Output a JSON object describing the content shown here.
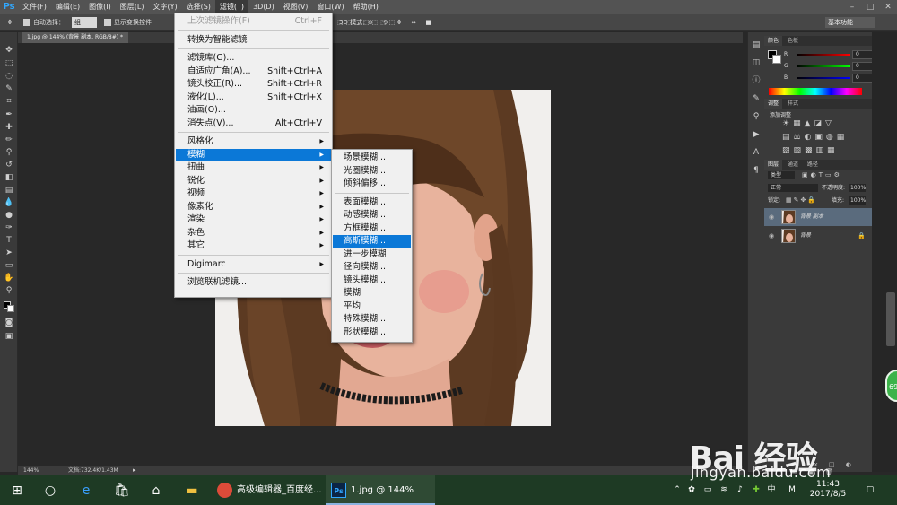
{
  "menubar": {
    "logo": "Ps",
    "items": [
      "文件(F)",
      "编辑(E)",
      "图像(I)",
      "图层(L)",
      "文字(Y)",
      "选择(S)",
      "滤镜(T)",
      "3D(D)",
      "视图(V)",
      "窗口(W)",
      "帮助(H)"
    ],
    "active_index": 6
  },
  "options_bar": {
    "auto_select_label": "自动选择：",
    "auto_select_value": "组",
    "transform_label": "显示变换控件",
    "mode_label": "3D 模式：",
    "workspace": "基本功能"
  },
  "document": {
    "tab_title": "1.jpg @ 144% (背景 副本, RGB/8#) *"
  },
  "status_bar": {
    "zoom": "144%",
    "doc_info": "文档:732.4K/1.43M"
  },
  "filter_menu": {
    "items": [
      {
        "label": "上次滤镜操作(F)",
        "shortcut": "Ctrl+F",
        "disabled": true
      },
      {
        "sep": true
      },
      {
        "label": "转换为智能滤镜"
      },
      {
        "sep": true
      },
      {
        "label": "滤镜库(G)..."
      },
      {
        "label": "自适应广角(A)...",
        "shortcut": "Shift+Ctrl+A"
      },
      {
        "label": "镜头校正(R)...",
        "shortcut": "Shift+Ctrl+R"
      },
      {
        "label": "液化(L)...",
        "shortcut": "Shift+Ctrl+X"
      },
      {
        "label": "油画(O)..."
      },
      {
        "label": "消失点(V)...",
        "shortcut": "Alt+Ctrl+V"
      },
      {
        "sep": true
      },
      {
        "label": "风格化",
        "submenu": true
      },
      {
        "label": "模糊",
        "submenu": true,
        "highlighted": true
      },
      {
        "label": "扭曲",
        "submenu": true
      },
      {
        "label": "锐化",
        "submenu": true
      },
      {
        "label": "视频",
        "submenu": true
      },
      {
        "label": "像素化",
        "submenu": true
      },
      {
        "label": "渲染",
        "submenu": true
      },
      {
        "label": "杂色",
        "submenu": true
      },
      {
        "label": "其它",
        "submenu": true
      },
      {
        "sep": true
      },
      {
        "label": "Digimarc",
        "submenu": true
      },
      {
        "sep": true
      },
      {
        "label": "浏览联机滤镜..."
      }
    ]
  },
  "blur_menu": {
    "items": [
      {
        "label": "场景模糊..."
      },
      {
        "label": "光圈模糊..."
      },
      {
        "label": "倾斜偏移..."
      },
      {
        "sep": true
      },
      {
        "label": "表面模糊..."
      },
      {
        "label": "动感模糊..."
      },
      {
        "label": "方框模糊..."
      },
      {
        "label": "高斯模糊...",
        "highlighted": true
      },
      {
        "label": "进一步模糊"
      },
      {
        "label": "径向模糊..."
      },
      {
        "label": "镜头模糊..."
      },
      {
        "label": "模糊"
      },
      {
        "label": "平均"
      },
      {
        "label": "特殊模糊..."
      },
      {
        "label": "形状模糊..."
      }
    ]
  },
  "color_panel": {
    "tabs": [
      "颜色",
      "色板"
    ],
    "channels": [
      {
        "label": "R",
        "value": "0",
        "color": "#e03030"
      },
      {
        "label": "G",
        "value": "0",
        "color": "#30c030"
      },
      {
        "label": "B",
        "value": "0",
        "color": "#3050e0"
      }
    ]
  },
  "adjust_panel": {
    "tabs": [
      "调整",
      "样式"
    ],
    "title": "添加调整"
  },
  "layers_panel": {
    "tabs": [
      "图层",
      "通道",
      "路径"
    ],
    "filter_label": "类型",
    "blend_mode": "正常",
    "opacity_label": "不透明度:",
    "opacity": "100%",
    "lock_label": "锁定:",
    "fill_label": "填充:",
    "fill": "100%",
    "layers": [
      {
        "name": "背景 副本",
        "selected": true
      },
      {
        "name": "背景",
        "selected": false
      }
    ]
  },
  "taskbar": {
    "apps": [
      {
        "label": "高级编辑器_百度经...",
        "badge": "●",
        "color": "#dd4b39"
      },
      {
        "label": "1.jpg @ 144% (背...",
        "badge": "Ps",
        "color": "#0b2545"
      }
    ],
    "ime": "中",
    "time": "11:43",
    "date": "2017/8/5"
  },
  "watermark": {
    "logo": "Bai 经验",
    "url": "jingyan.baidu.com",
    "badge": "69"
  }
}
